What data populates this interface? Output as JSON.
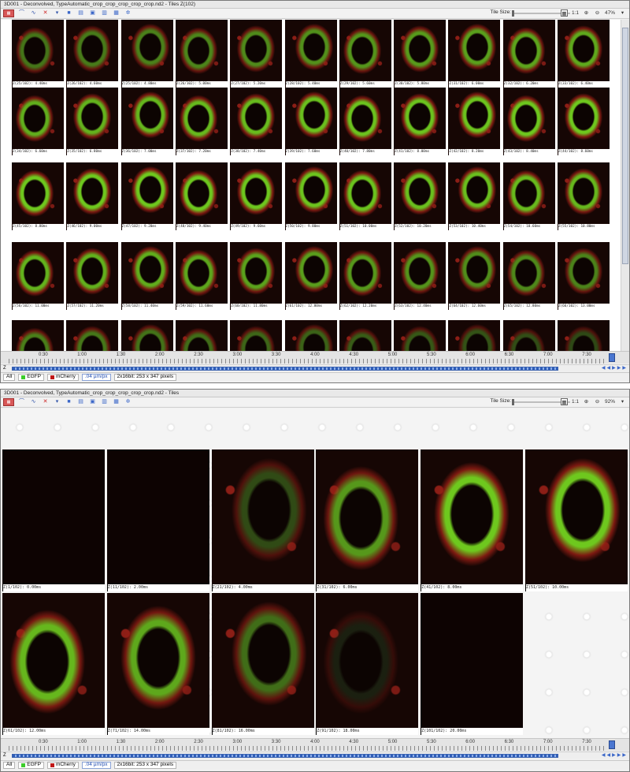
{
  "windows": [
    {
      "title": "3D001 - Deconvolved, TypeAutomatic_crop_crop_crop_crop_crop.nd2 - Tiles  Z(102)",
      "toolbar": {
        "tile_size_label": "Tile Size:",
        "ratio_label": "1:1",
        "zoom": "47%"
      },
      "timeline_labels": [
        "0:30",
        "1:00",
        "1:30",
        "2:00",
        "2:30",
        "3:00",
        "3:30",
        "4:00",
        "4:30",
        "5:00",
        "5:30",
        "6:00",
        "6:30",
        "7:00",
        "7:30"
      ],
      "zbar_label": "Z",
      "status": {
        "tab_all": "All",
        "ch1": "EGFP",
        "ch2": "mCherry",
        "resolution": ".04 µm/px",
        "info": "2x16bit: 253 x 347 pixels"
      },
      "tiles": [
        "Z(25/102): 4.40ms",
        "Z(26/102): 4.60ms",
        "Z(25/102): 4.80ms",
        "Z(26/102): 5.00ms",
        "Z(27/102): 5.20ms",
        "Z(28/102): 5.40ms",
        "Z(29/102): 5.60ms",
        "Z(30/102): 5.80ms",
        "Z(31/102): 6.00ms",
        "Z(32/102): 6.20ms",
        "Z(33/102): 6.40ms",
        "Z(34/102): 6.60ms",
        "Z(35/102): 6.80ms",
        "Z(36/102): 7.00ms",
        "Z(37/102): 7.20ms",
        "Z(38/102): 7.40ms",
        "Z(39/102): 7.60ms",
        "Z(40/102): 7.80ms",
        "Z(41/102): 8.00ms",
        "Z(42/102): 8.20ms",
        "Z(43/102): 8.40ms",
        "Z(44/102): 8.60ms",
        "Z(45/102): 8.80ms",
        "Z(46/102): 9.00ms",
        "Z(47/102): 9.20ms",
        "Z(48/102): 9.40ms",
        "Z(49/102): 9.60ms",
        "Z(50/102): 9.80ms",
        "Z(51/102): 10.00ms",
        "Z(52/102): 10.20ms",
        "Z(53/102): 10.40ms",
        "Z(54/102): 10.60ms",
        "Z(55/102): 10.80ms",
        "Z(56/102): 11.00ms",
        "Z(57/102): 11.20ms",
        "Z(58/102): 11.40ms",
        "Z(59/102): 11.60ms",
        "Z(60/102): 11.80ms",
        "Z(61/102): 12.00ms",
        "Z(62/102): 12.20ms",
        "Z(63/102): 12.40ms",
        "Z(64/102): 12.60ms",
        "Z(65/102): 12.80ms",
        "Z(66/102): 13.00ms",
        "",
        "",
        "",
        "",
        "",
        "",
        "",
        "",
        "",
        "",
        ""
      ]
    },
    {
      "title": "3D001 - Deconvolved, TypeAutomatic_crop_crop_crop_crop_crop.nd2 - Tiles",
      "toolbar": {
        "tile_size_label": "Tile Size:",
        "ratio_label": "1:1",
        "zoom": "92%"
      },
      "timeline_labels": [
        "0:30",
        "1:00",
        "1:30",
        "2:00",
        "2:30",
        "3:00",
        "3:30",
        "4:00",
        "4:30",
        "5:00",
        "5:30",
        "6:00",
        "6:30",
        "7:00",
        "7:30"
      ],
      "zbar_label": "Z",
      "status": {
        "tab_all": "All",
        "ch1": "EGFP",
        "ch2": "mCherry",
        "resolution": ".04 µm/px",
        "info": "2x16bit: 253 x 347 pixels"
      },
      "tiles": [
        "Z(1/102): 0.00ms",
        "Z(11/102): 2.00ms",
        "Z(21/102): 4.00ms",
        "Z(31/102): 6.00ms",
        "Z(41/102): 8.00ms",
        "Z(51/102): 10.00ms",
        "Z(61/102): 12.00ms",
        "Z(71/102): 14.00ms",
        "Z(81/102): 16.00ms",
        "Z(91/102): 18.00ms",
        "Z(101/102): 20.00ms"
      ]
    }
  ],
  "colors": {
    "egfp": "#3ccc2a",
    "mcherry": "#c01818",
    "accent": "#3a66c8"
  }
}
